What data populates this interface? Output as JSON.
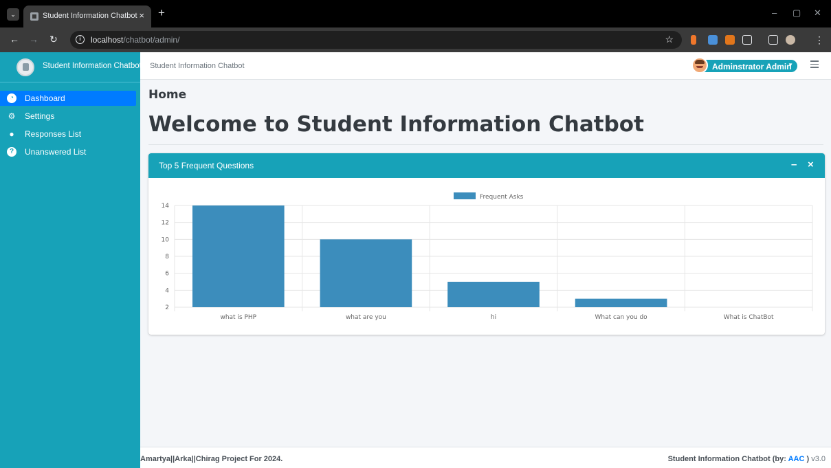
{
  "browser": {
    "tab_title": "Student Information Chatbot",
    "tab_close": "×",
    "new_tab": "+",
    "url_host": "localhost",
    "url_path": "/chatbot/admin/"
  },
  "sidebar": {
    "brand": "Student Information Chatbot",
    "items": [
      {
        "label": "Dashboard",
        "icon": "dashboard-icon",
        "active": true
      },
      {
        "label": "Settings",
        "icon": "cogs-icon",
        "active": false
      },
      {
        "label": "Responses List",
        "icon": "comment-icon",
        "active": false
      },
      {
        "label": "Unanswered List",
        "icon": "question-icon",
        "active": false
      }
    ]
  },
  "navbar": {
    "title": "Student Information Chatbot",
    "user": "Adminstrator Admin"
  },
  "content": {
    "breadcrumb": "Home",
    "welcome": "Welcome to Student Information Chatbot"
  },
  "card": {
    "title": "Top 5 Frequent Questions",
    "minimize": "–",
    "close": "×"
  },
  "chart_data": {
    "type": "bar",
    "categories": [
      "what is PHP",
      "what are you",
      "hi",
      "What can you do",
      "What is ChatBot"
    ],
    "series": [
      {
        "name": "Frequent Asks",
        "values": [
          14,
          10,
          5,
          3,
          2
        ],
        "color": "#3c8dbc"
      }
    ],
    "ylim": [
      2,
      14
    ],
    "yticks": [
      2,
      4,
      6,
      8,
      10,
      12,
      14
    ],
    "legend": "top",
    "grid": true
  },
  "footer": {
    "left": "Amartya||Arka||Chirag Project For 2024.",
    "right_brand": "Student Information Chatbot (by: ",
    "right_author": "AAC",
    "right_close": " )",
    "version": " v3.0"
  },
  "colors": {
    "accent": "#17a2b8",
    "active": "#007bff",
    "bar": "#3c8dbc"
  }
}
